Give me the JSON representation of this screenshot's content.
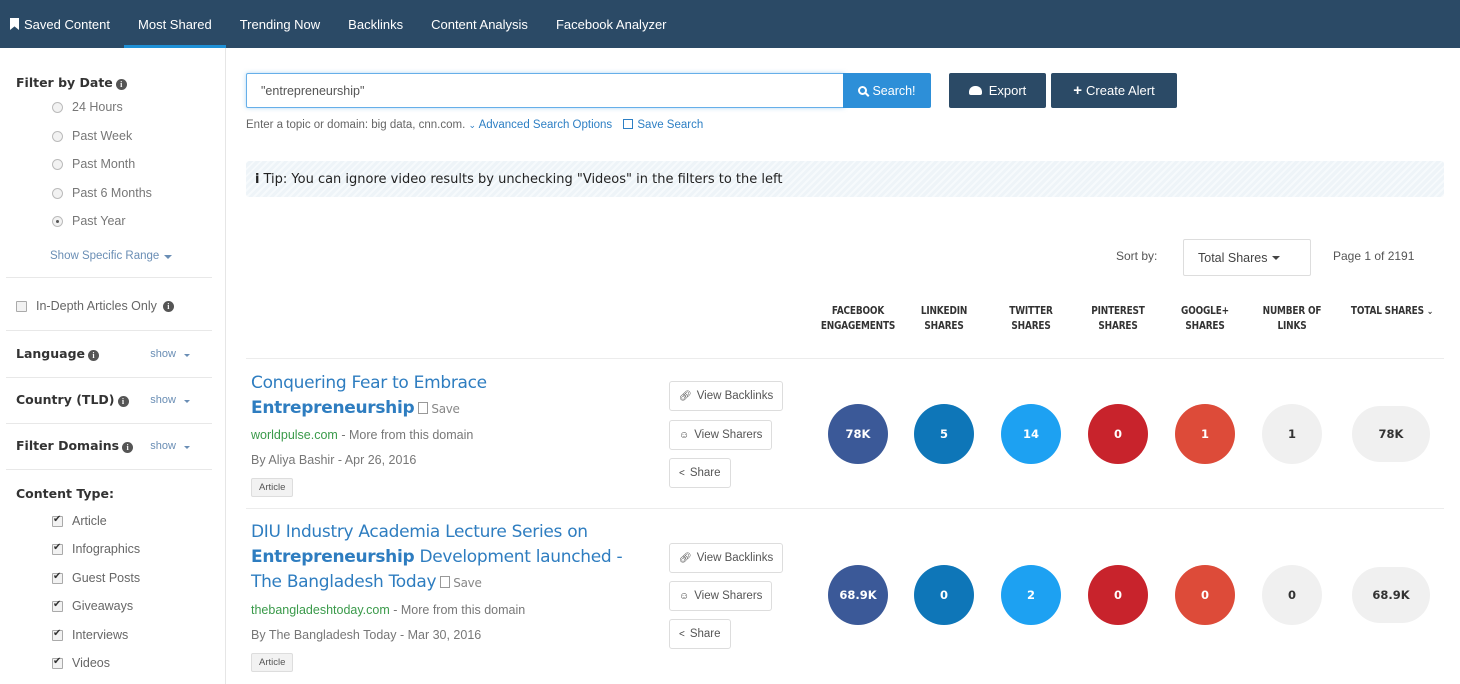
{
  "nav": {
    "tabs": [
      {
        "label": "Saved Content"
      },
      {
        "label": "Most Shared"
      },
      {
        "label": "Trending Now"
      },
      {
        "label": "Backlinks"
      },
      {
        "label": "Content Analysis"
      },
      {
        "label": "Facebook Analyzer"
      }
    ],
    "active": "Most Shared"
  },
  "sidebar": {
    "filter_by_date": "Filter by Date",
    "date_options": [
      "24 Hours",
      "Past Week",
      "Past Month",
      "Past 6 Months",
      "Past Year"
    ],
    "date_selected": "Past Year",
    "show_specific_range": "Show Specific Range",
    "in_depth_label": "In-Depth Articles Only",
    "language": "Language",
    "country": "Country (TLD)",
    "filter_domains": "Filter Domains",
    "show": "show",
    "content_type": "Content Type:",
    "content_types": [
      "Article",
      "Infographics",
      "Guest Posts",
      "Giveaways",
      "Interviews",
      "Videos"
    ]
  },
  "search": {
    "value": "\"entrepreneurship\"",
    "button": "Search!",
    "export": "Export",
    "create_alert": "Create Alert",
    "help": "Enter a topic or domain: big data, cnn.com.",
    "advanced": "Advanced Search Options",
    "save_search": "Save Search"
  },
  "tip": {
    "prefix": "Tip:",
    "text": "You can ignore video results by unchecking \"Videos\" in the filters to the left"
  },
  "sort": {
    "label": "Sort by:",
    "selected": "Total Shares",
    "page_info": "Page 1 of 2191"
  },
  "columns": [
    {
      "l1": "FACEBOOK",
      "l2": "ENGAGEMENTS"
    },
    {
      "l1": "LINKEDIN",
      "l2": "SHARES"
    },
    {
      "l1": "TWITTER",
      "l2": "SHARES"
    },
    {
      "l1": "PINTEREST",
      "l2": "SHARES"
    },
    {
      "l1": "GOOGLE+",
      "l2": "SHARES"
    },
    {
      "l1": "NUMBER OF",
      "l2": "LINKS"
    },
    {
      "l1": "TOTAL SHARES",
      "l2": ""
    }
  ],
  "actions": {
    "view_backlinks": "View Backlinks",
    "view_sharers": "View Sharers",
    "share": "Share",
    "save": "Save",
    "more_from_domain": "- More from this domain"
  },
  "results": [
    {
      "title_l1": "Conquering Fear to Embrace",
      "title_bold": "Entrepreneurship",
      "title_rest": "",
      "domain": "worldpulse.com",
      "byline": "By Aliya Bashir - Apr 26, 2016",
      "tag": "Article",
      "metrics": [
        "78K",
        "5",
        "14",
        "0",
        "1",
        "1",
        "78K"
      ]
    },
    {
      "title_l1": "DIU Industry Academia Lecture Series on",
      "title_bold": "Entrepreneurship",
      "title_rest": " Development launched -",
      "title_l3": "The Bangladesh Today",
      "domain": "thebangladeshtoday.com",
      "byline": "By The Bangladesh Today - Mar 30, 2016",
      "tag": "Article",
      "metrics": [
        "68.9K",
        "0",
        "2",
        "0",
        "0",
        "0",
        "68.9K"
      ]
    }
  ],
  "colors": {
    "nav_bg": "#2b4a66",
    "facebook": "#3b5998",
    "linkedin": "#0e76b8",
    "twitter": "#1da1f2",
    "pinterest": "#c8232c",
    "googleplus": "#dd4b39",
    "neutral": "#f0f0f0"
  }
}
